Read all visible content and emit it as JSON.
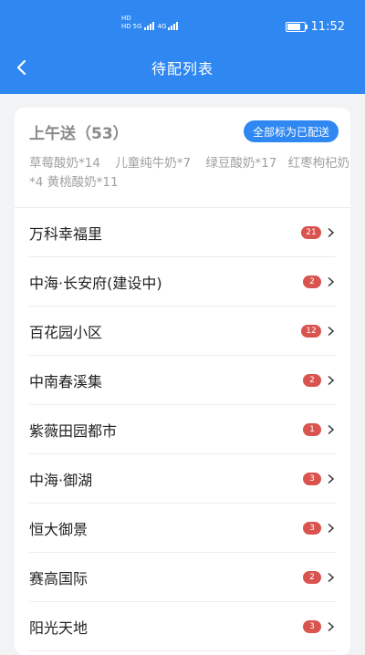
{
  "status_bar": {
    "time": "11:52",
    "hd1": "HD",
    "hd2": "HD",
    "net1": "5G",
    "net2": "4G"
  },
  "header": {
    "title": "待配列表"
  },
  "section": {
    "title": "上午送（53）",
    "mark_all_label": "全部标为已配送",
    "products": [
      "草莓酸奶*14",
      "儿童纯牛奶*7",
      "绿豆酸奶*17",
      "红枣枸杞奶*4",
      "黄桃酸奶*11"
    ]
  },
  "locations": [
    {
      "name": "万科幸福里",
      "count": "21"
    },
    {
      "name": "中海·长安府(建设中)",
      "count": "2"
    },
    {
      "name": "百花园小区",
      "count": "12"
    },
    {
      "name": "中南春溪集",
      "count": "2"
    },
    {
      "name": "紫薇田园都市",
      "count": "1"
    },
    {
      "name": "中海·御湖",
      "count": "3"
    },
    {
      "name": "恒大御景",
      "count": "3"
    },
    {
      "name": "赛高国际",
      "count": "2"
    },
    {
      "name": "阳光天地",
      "count": "3"
    }
  ],
  "colors": {
    "primary": "#2f87f2",
    "badge": "#d9534f",
    "background": "#f2f3f5"
  },
  "icons": {
    "back": "chevron-left-icon",
    "row_arrow": "chevron-right-icon"
  }
}
